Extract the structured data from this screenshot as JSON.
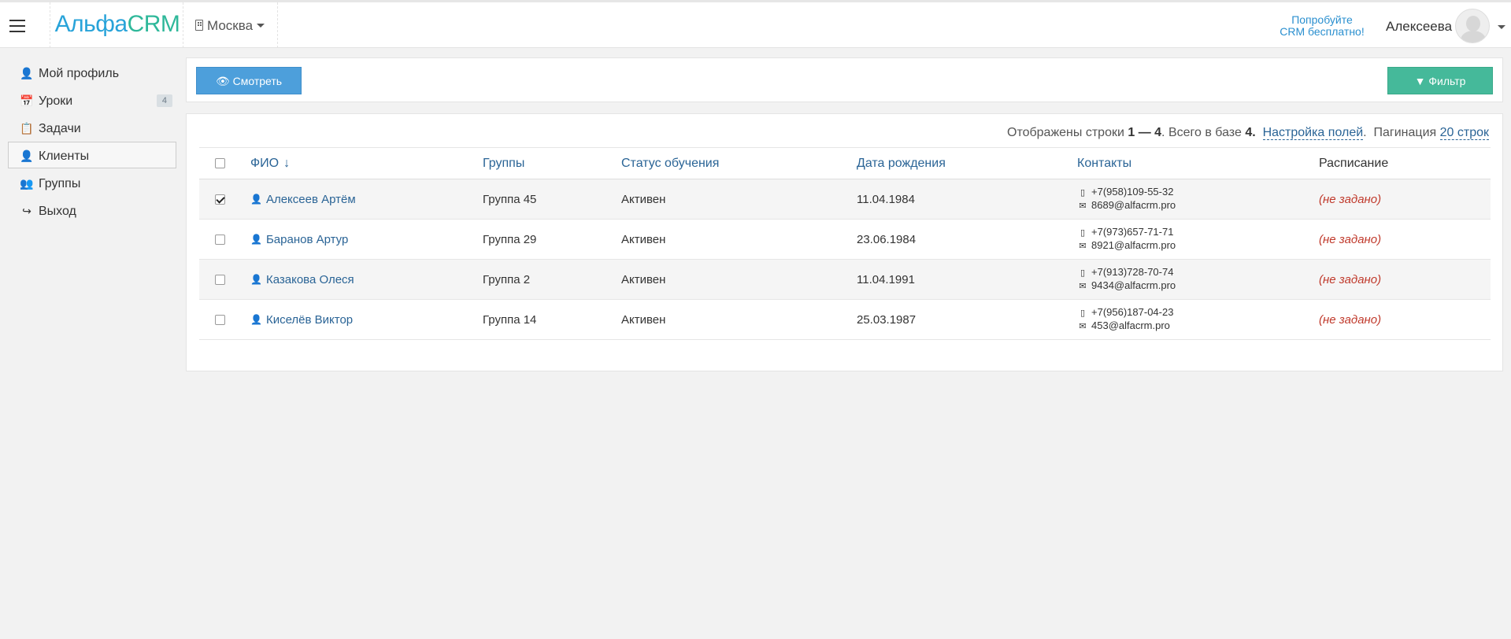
{
  "header": {
    "logo_a": "Альфа",
    "logo_b": "CRM",
    "city": "Москва",
    "promo_line1": "Попробуйте",
    "promo_line2": "CRM бесплатно!",
    "username": "Алексеева"
  },
  "sidebar": {
    "items": [
      {
        "label": "Мой профиль",
        "icon": "user-icon"
      },
      {
        "label": "Уроки",
        "icon": "calendar-icon",
        "badge": "4"
      },
      {
        "label": "Задачи",
        "icon": "clipboard-icon"
      },
      {
        "label": "Клиенты",
        "icon": "user-icon",
        "active": true
      },
      {
        "label": "Группы",
        "icon": "users-icon"
      },
      {
        "label": "Выход",
        "icon": "logout-icon"
      }
    ]
  },
  "toolbar": {
    "view_label": "Смотреть",
    "filter_label": "Фильтр"
  },
  "summary": {
    "prefix": "Отображены строки",
    "range": "1 — 4",
    "middle": ". Всего в базе",
    "total": "4",
    "fields_link": "Настройка полей",
    "pagination_label": "Пагинация",
    "pagination_link": "20 строк"
  },
  "table": {
    "columns": [
      "ФИО",
      "Группы",
      "Статус обучения",
      "Дата рождения",
      "Контакты",
      "Расписание"
    ],
    "sort_indicator": "↓",
    "rows": [
      {
        "checked": true,
        "name": "Алексеев Артём",
        "group": "Группа 45",
        "status": "Активен",
        "birth": "11.04.1984",
        "phone": "+7(958)109-55-32",
        "email": "8689@alfacrm.pro",
        "schedule": "(не задано)"
      },
      {
        "checked": false,
        "name": "Баранов Артур",
        "group": "Группа 29",
        "status": "Активен",
        "birth": "23.06.1984",
        "phone": "+7(973)657-71-71",
        "email": "8921@alfacrm.pro",
        "schedule": "(не задано)"
      },
      {
        "checked": false,
        "name": "Казакова Олеся",
        "group": "Группа 2",
        "status": "Активен",
        "birth": "11.04.1991",
        "phone": "+7(913)728-70-74",
        "email": "9434@alfacrm.pro",
        "schedule": "(не задано)"
      },
      {
        "checked": false,
        "name": "Киселёв Виктор",
        "group": "Группа 14",
        "status": "Активен",
        "birth": "25.03.1987",
        "phone": "+7(956)187-04-23",
        "email": "453@alfacrm.pro",
        "schedule": "(не задано)"
      }
    ]
  }
}
